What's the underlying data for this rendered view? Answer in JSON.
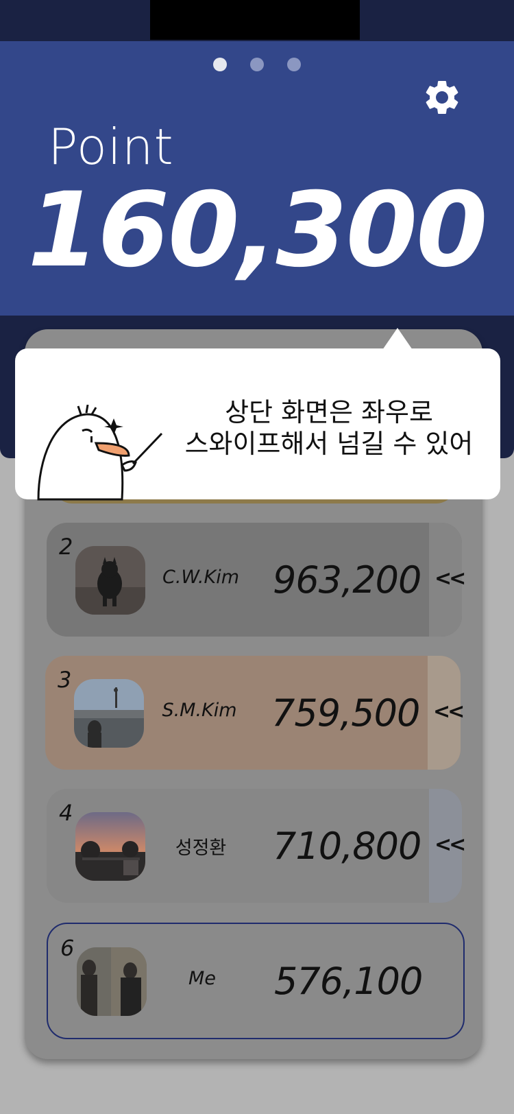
{
  "header": {
    "page_dots": 3,
    "active_dot": 0,
    "point_label": "Point",
    "point_value": "160,300",
    "settings_icon": "gear-icon"
  },
  "tooltip": {
    "line1": "상단 화면은 좌우로",
    "line2": "스와이프해서 넘길 수 있어",
    "mascot_icon": "bird-mascot-icon"
  },
  "ranking": {
    "rows": [
      {
        "rank": "2",
        "name": "C.W.Kim",
        "score": "963,200",
        "action": "<<"
      },
      {
        "rank": "3",
        "name": "S.M.Kim",
        "score": "759,500",
        "action": "<<"
      },
      {
        "rank": "4",
        "name": "성정환",
        "score": "710,800",
        "action": "<<"
      },
      {
        "rank": "6",
        "name": "Me",
        "score": "576,100"
      }
    ]
  },
  "colors": {
    "header_bg": "#33478a",
    "status_bg": "#1a2243",
    "row_3_bg": "#9b8474",
    "me_border": "#1f2b6d"
  }
}
